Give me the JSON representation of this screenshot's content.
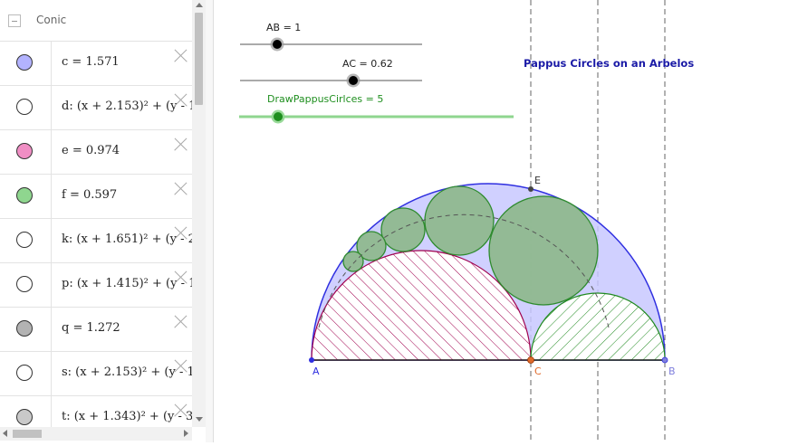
{
  "algebra": {
    "group_label": "Conic",
    "items": [
      {
        "text": "c = 1.571",
        "color": "#b3b3ff"
      },
      {
        "text": "d: (x + 2.153)² + (y - 1",
        "color": "#ffffff"
      },
      {
        "text": "e = 0.974",
        "color": "#f08ec4"
      },
      {
        "text": "f = 0.597",
        "color": "#8fd68f"
      },
      {
        "text": "k: (x + 1.651)² + (y - 2",
        "color": "#ffffff"
      },
      {
        "text": "p: (x + 1.415)² + (y - 1",
        "color": "#ffffff"
      },
      {
        "text": "q = 1.272",
        "color": "#b3b3b3"
      },
      {
        "text": "s: (x + 2.153)² + (y - 1.",
        "color": "#ffffff"
      },
      {
        "text": "t: (x + 1.343)² + (y - 3.",
        "color": "#c9c9c9"
      }
    ]
  },
  "sliders": {
    "ab_label": "AB = 1",
    "ac_label": "AC = 0.62",
    "pappus_label": "DrawPappusCirlces = 5",
    "ab_value": 1,
    "ac_value": 0.62,
    "pappus_value": 5
  },
  "graphics": {
    "title": "Pappus Circles on an Arbelos",
    "point_a": "A",
    "point_b": "B",
    "point_c": "C",
    "point_e": "E"
  },
  "colors": {
    "title": "#1a1aa6",
    "arbelos_fill": "#c8c8ff",
    "arbelos_stroke": "#2f2fe0",
    "pappus_fill": "#8fb88f",
    "pappus_stroke": "#2e8b2e",
    "hatch_red": "#a0004e",
    "hatch_green": "#208a20",
    "point_c": "#e06a2a",
    "slider_green": "#1f8f1f"
  }
}
